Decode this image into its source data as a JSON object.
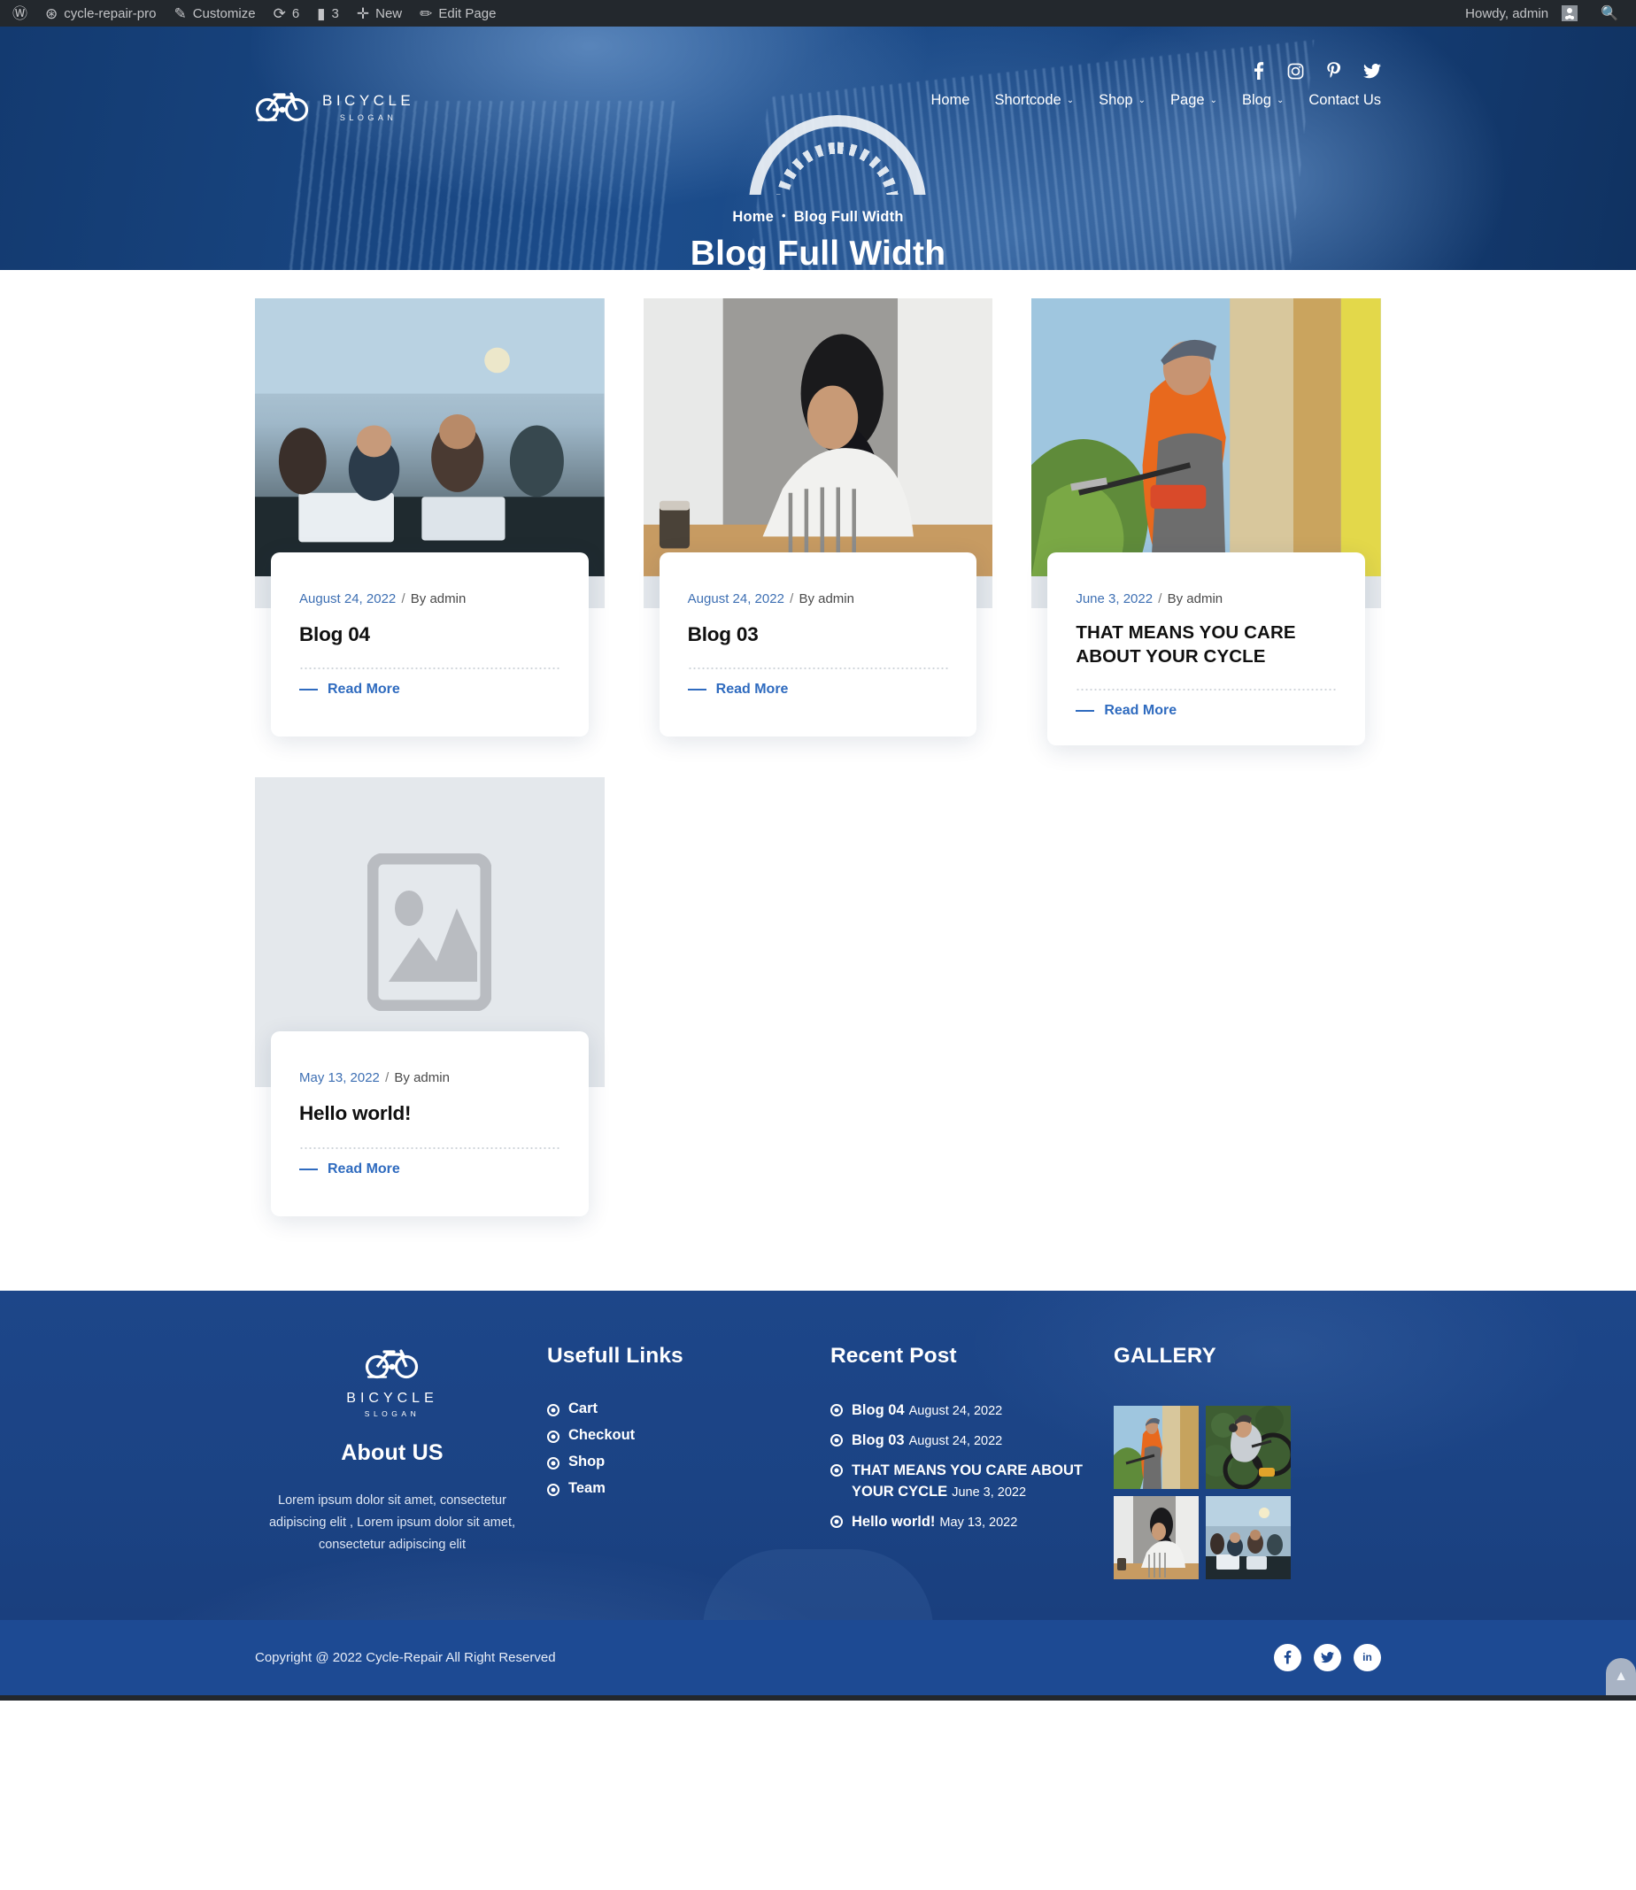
{
  "adminbar": {
    "wp_icon": "wordpress-icon",
    "site_name": "cycle-repair-pro",
    "customize": "Customize",
    "updates_count": "6",
    "comments_count": "3",
    "new_label": "New",
    "edit_page": "Edit Page",
    "howdy": "Howdy, admin",
    "search_icon": "search-icon"
  },
  "header": {
    "logo": {
      "line1": "BICYCLE",
      "line2": "SLOGAN"
    },
    "socials": [
      {
        "name": "facebook-icon",
        "glyph": "f"
      },
      {
        "name": "instagram-icon",
        "glyph": "◙"
      },
      {
        "name": "pinterest-icon",
        "glyph": "P"
      },
      {
        "name": "twitter-icon",
        "glyph": "🐦"
      }
    ],
    "nav": [
      {
        "label": "Home",
        "has_caret": false
      },
      {
        "label": "Shortcode",
        "has_caret": true
      },
      {
        "label": "Shop",
        "has_caret": true
      },
      {
        "label": "Page",
        "has_caret": true
      },
      {
        "label": "Blog",
        "has_caret": true
      },
      {
        "label": "Contact Us",
        "has_caret": false
      }
    ]
  },
  "hero": {
    "breadcrumb_home": "Home",
    "breadcrumb_dot": "•",
    "breadcrumb_current": "Blog Full Width",
    "title": "Blog Full Width"
  },
  "posts": [
    {
      "date": "August 24, 2022",
      "separator": "/",
      "author": "By admin",
      "title": "Blog 04",
      "read_more": "Read More",
      "image": "meeting-room-photo",
      "has_image": true
    },
    {
      "date": "August 24, 2022",
      "separator": "/",
      "author": "By admin",
      "title": "Blog 03",
      "read_more": "Read More",
      "image": "woman-at-laptop-photo",
      "has_image": true
    },
    {
      "date": "June 3, 2022",
      "separator": "/",
      "author": "By admin",
      "title": "THAT MEANS YOU CARE ABOUT YOUR CYCLE",
      "read_more": "Read More",
      "image": "gardener-photo",
      "has_image": true
    },
    {
      "date": "May 13, 2022",
      "separator": "/",
      "author": "By admin",
      "title": "Hello world!",
      "read_more": "Read More",
      "image": "image-placeholder-icon",
      "has_image": false
    }
  ],
  "footer": {
    "logo": {
      "line1": "BICYCLE",
      "line2": "SLOGAN"
    },
    "about_heading": "About US",
    "about_text": "Lorem ipsum dolor sit amet, consectetur adipiscing elit , Lorem ipsum dolor sit amet, consectetur adipiscing elit",
    "useful_links_heading": "Usefull Links",
    "useful_links": [
      "Cart",
      "Checkout",
      "Shop",
      "Team"
    ],
    "recent_post_heading": "Recent Post",
    "recent_posts": [
      {
        "title": "Blog 04",
        "date": "August 24, 2022"
      },
      {
        "title": "Blog 03",
        "date": "August 24, 2022"
      },
      {
        "title": "THAT MEANS YOU CARE ABOUT YOUR CYCLE",
        "date": "June 3, 2022"
      },
      {
        "title": "Hello world!",
        "date": "May 13, 2022"
      }
    ],
    "gallery_heading": "GALLERY",
    "gallery": [
      "gardener-thumb",
      "bike-repair-thumb",
      "woman-laptop-thumb",
      "meeting-room-thumb"
    ]
  },
  "bottombar": {
    "copyright": "Copyright @ 2022 Cycle-Repair All Right Reserved",
    "socials": [
      {
        "name": "facebook-icon",
        "glyph": "f"
      },
      {
        "name": "twitter-icon",
        "glyph": "🐦"
      },
      {
        "name": "linkedin-icon",
        "glyph": "in"
      }
    ],
    "back_to_top": "▲"
  },
  "colors": {
    "admin_bar": "#23282d",
    "brand_blue": "#16417c",
    "footer_blue": "#1c4486",
    "bottom_blue": "#1d4a93",
    "link_blue": "#2f6bbf",
    "meta_blue": "#3d6fb3"
  }
}
